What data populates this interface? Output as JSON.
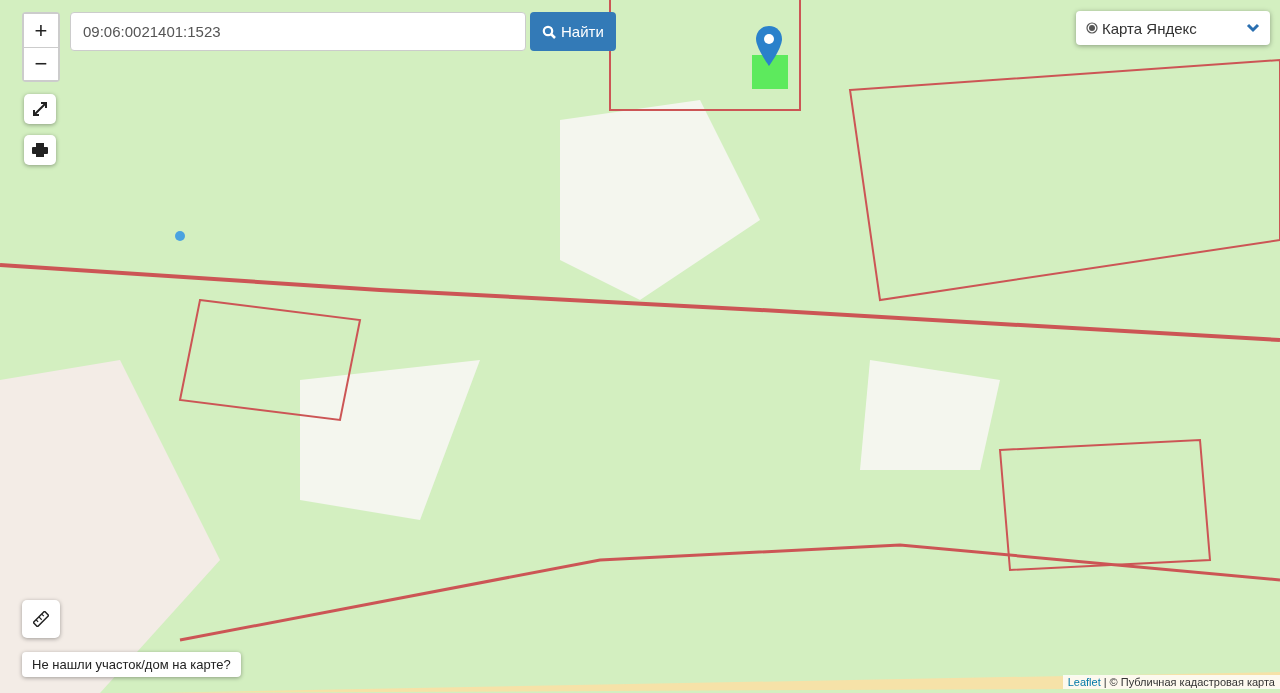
{
  "zoom": {
    "in": "+",
    "out": "−"
  },
  "search": {
    "value": "09:06:0021401:1523",
    "button": "Найти"
  },
  "layer_select": {
    "label": "Карта Яндекс",
    "selected": true
  },
  "help_button": "Не нашли участок/дом на карте?",
  "attribution": {
    "link": "Leaflet",
    "separator": "|",
    "text": "© Публичная кадастровая карта"
  }
}
